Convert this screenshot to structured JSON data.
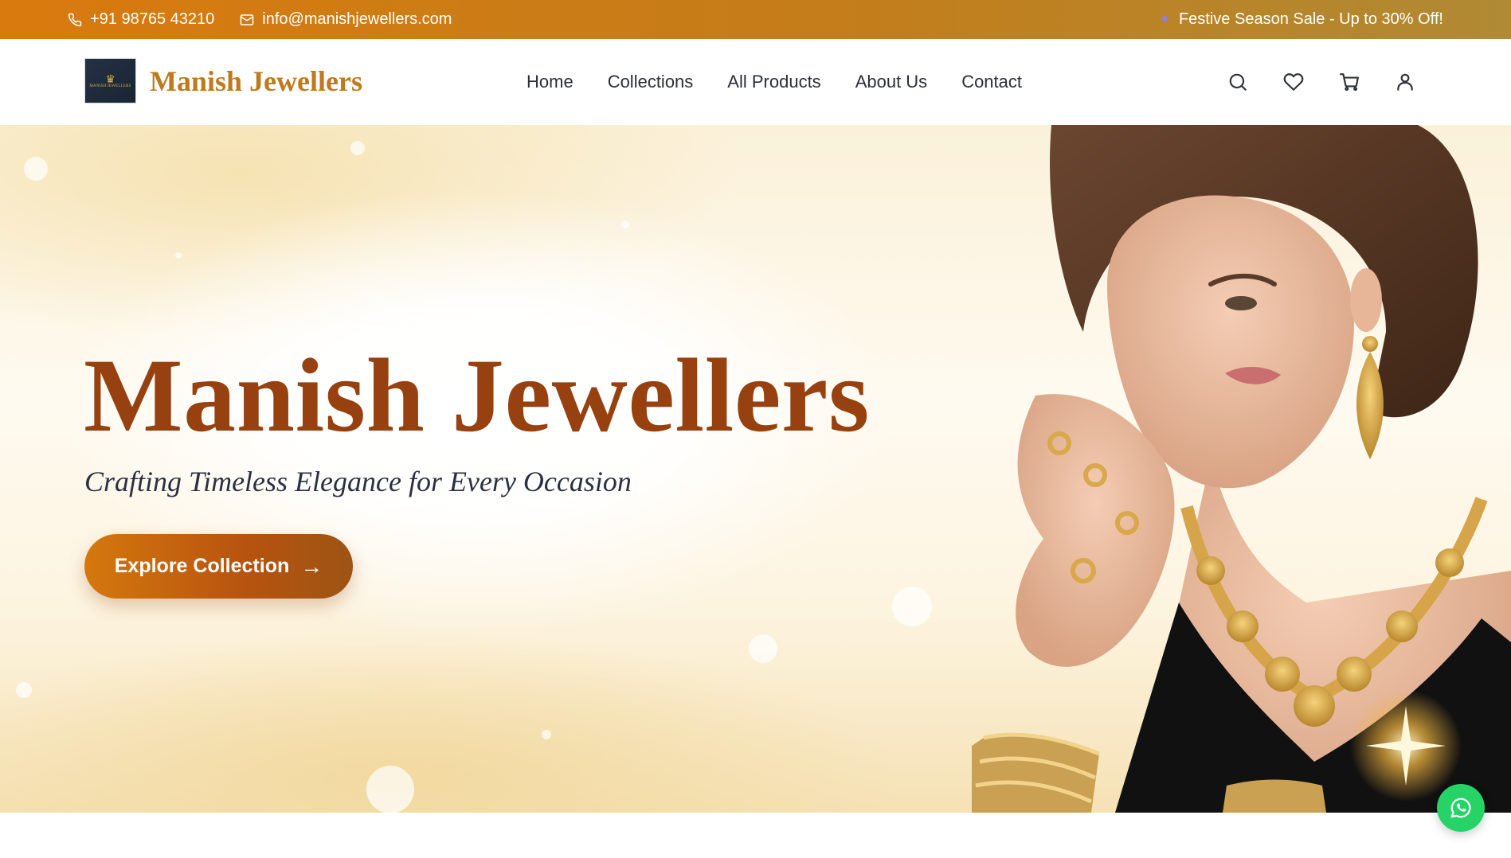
{
  "topbar": {
    "phone": "+91 98765 43210",
    "email": "info@manishjewellers.com",
    "promo": "Festive Season Sale - Up to 30% Off!",
    "phone_icon": "phone-icon",
    "email_icon": "mail-icon",
    "promo_icon": "sparkle-icon"
  },
  "header": {
    "brand": "Manish Jewellers",
    "logo_text": "MANISH JEWELLERS",
    "nav": [
      "Home",
      "Collections",
      "All Products",
      "About Us",
      "Contact"
    ],
    "tools": [
      "search-icon",
      "heart-icon",
      "cart-icon",
      "user-icon"
    ]
  },
  "hero": {
    "title": "Manish Jewellers",
    "subtitle": "Crafting Timeless Elegance for Every Occasion",
    "cta_label": "Explore Collection",
    "cta_arrow": "→"
  },
  "colors": {
    "accent": "#c07a1c",
    "title": "#96410f",
    "topbar_start": "#d97a0e",
    "topbar_end": "#b08a34",
    "whatsapp": "#25d366"
  }
}
